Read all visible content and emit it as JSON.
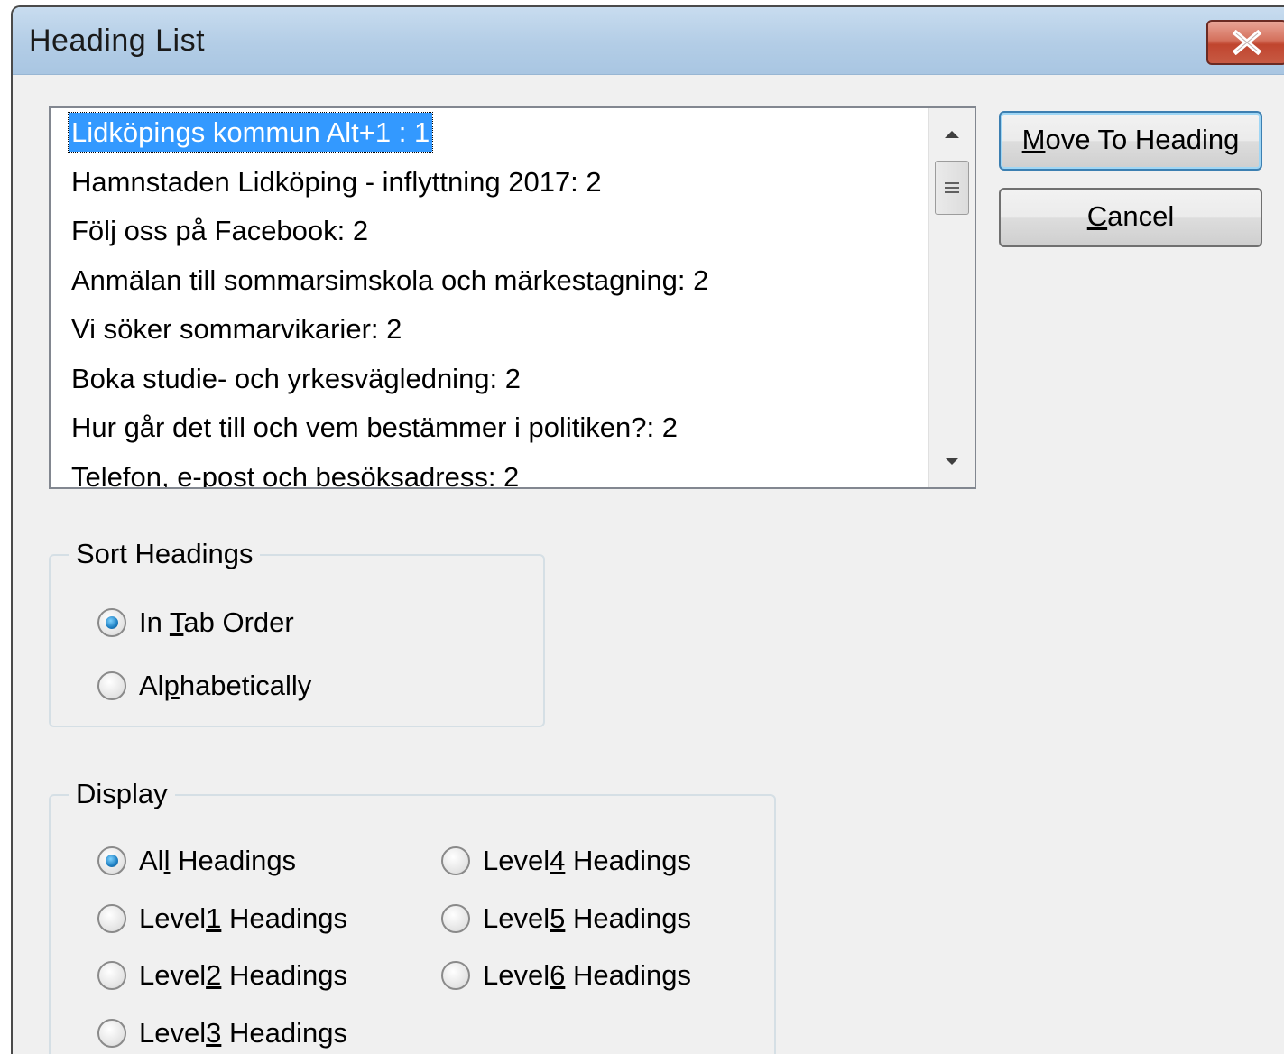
{
  "window": {
    "title": "Heading List"
  },
  "headings_list": {
    "items": [
      "Lidköpings kommun Alt+1 : 1",
      "Hamnstaden Lidköping - inflyttning 2017: 2",
      "Följ oss på Facebook: 2",
      "Anmälan till sommarsimskola och märkestagning: 2",
      "Vi söker sommarvikarier: 2",
      "Boka studie- och yrkesvägledning: 2",
      "Hur går det till och vem bestämmer i politiken?: 2",
      "Telefon, e-post och besöksadress: 2"
    ],
    "selected_index": 0
  },
  "buttons": {
    "move_to_heading": {
      "prefix": "",
      "accel": "M",
      "rest": "ove To Heading"
    },
    "cancel": {
      "prefix": "",
      "accel": "C",
      "rest": "ancel"
    }
  },
  "sort": {
    "label": "Sort Headings",
    "options": [
      {
        "prefix": "In ",
        "accel": "T",
        "rest": "ab Order",
        "checked": true
      },
      {
        "prefix": "Al",
        "accel": "p",
        "rest": "habetically",
        "checked": false
      }
    ]
  },
  "display": {
    "label": "Display",
    "options": [
      {
        "prefix": "Al",
        "accel": "l",
        "rest": " Headings",
        "checked": true
      },
      {
        "prefix": "Level",
        "accel": "1",
        "rest": " Headings",
        "checked": false
      },
      {
        "prefix": "Level",
        "accel": "2",
        "rest": " Headings",
        "checked": false
      },
      {
        "prefix": "Level",
        "accel": "3",
        "rest": " Headings",
        "checked": false
      },
      {
        "prefix": "Level",
        "accel": "4",
        "rest": " Headings",
        "checked": false
      },
      {
        "prefix": "Level",
        "accel": "5",
        "rest": " Headings",
        "checked": false
      },
      {
        "prefix": "Level",
        "accel": "6",
        "rest": " Headings",
        "checked": false
      }
    ]
  },
  "colors": {
    "selection": "#3399ff",
    "titlebar": "#b3cde6",
    "close_button": "#c75a44",
    "dialog_background": "#f0f0f0"
  },
  "icons": {
    "close": "close-x-icon",
    "scroll_up": "scroll-up-arrow-icon",
    "scroll_down": "scroll-down-arrow-icon",
    "thumb_grip": "scroll-grip-icon"
  }
}
